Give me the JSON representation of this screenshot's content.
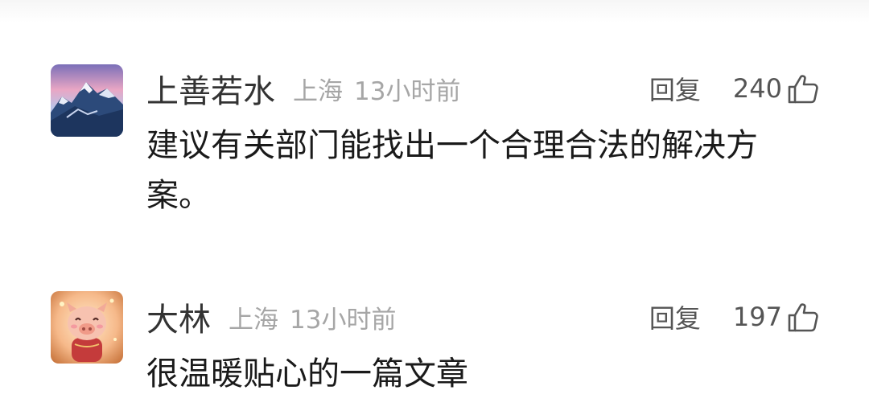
{
  "comments": [
    {
      "username": "上善若水",
      "location": "上海",
      "time": "13小时前",
      "reply_label": "回复",
      "likes": "240",
      "text": "建议有关部门能找出一个合理合法的解决方案。",
      "avatar": "snowy-mountain-avatar"
    },
    {
      "username": "大林",
      "location": "上海",
      "time": "13小时前",
      "reply_label": "回复",
      "likes": "197",
      "text": "很温暖贴心的一篇文章",
      "avatar": "cartoon-pig-avatar"
    }
  ],
  "icons": {
    "like": "thumbs-up-icon"
  },
  "colors": {
    "username": "#333333",
    "meta": "#a6a6a6",
    "text": "#1a1a1a",
    "action": "#555555"
  }
}
